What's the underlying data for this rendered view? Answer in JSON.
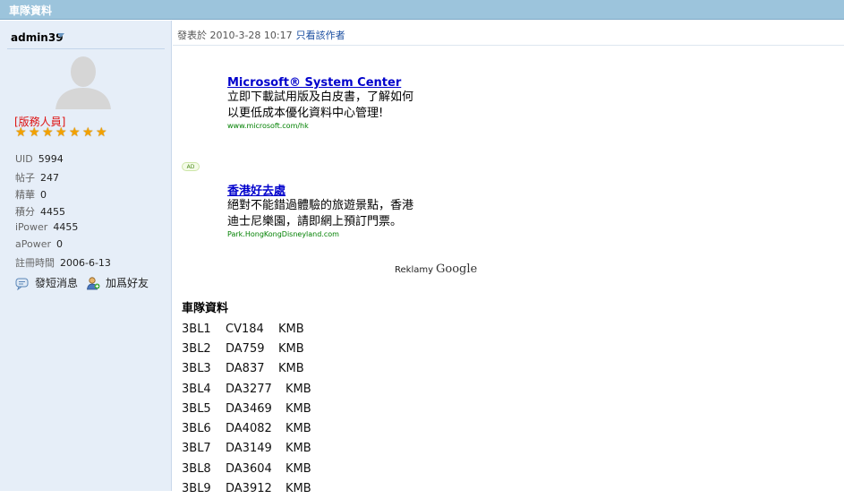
{
  "header": {
    "title": "車隊資料"
  },
  "profile": {
    "username": "admin39",
    "role": "[版務人員]",
    "star_count": 7,
    "stats": [
      {
        "label": "UID",
        "value": "5994"
      },
      {
        "label": "帖子",
        "value": "247"
      },
      {
        "label": "精華",
        "value": "0"
      },
      {
        "label": "積分",
        "value": "4455"
      },
      {
        "label": "iPower",
        "value": "4455"
      },
      {
        "label": "aPower",
        "value": "0"
      },
      {
        "label": "註冊時間",
        "value": "2006-6-13"
      }
    ],
    "actions": {
      "message": "發短消息",
      "add_friend": "加爲好友"
    }
  },
  "post": {
    "posted_at": "發表於 2010-3-28 10:17",
    "author_only_link": "只看該作者",
    "ads": [
      {
        "title": "Microsoft® System Center",
        "line1": "立即下載試用版及白皮書，了解如何",
        "line2": "以更低成本優化資料中心管理!",
        "url": "www.microsoft.com/hk"
      },
      {
        "title": "香港好去處",
        "line1": "絕對不能錯過體驗的旅遊景點，香港",
        "line2": "迪士尼樂園，請即網上預訂門票。",
        "url": "Park.HongKongDisneyland.com"
      }
    ],
    "ad_badge": "AD",
    "ads_label": "Reklamy",
    "ads_brand": "Google",
    "section_title": "車隊資料",
    "rows": [
      {
        "route": "3BL1",
        "code": "CV184",
        "op": "KMB"
      },
      {
        "route": "3BL2",
        "code": "DA759",
        "op": "KMB"
      },
      {
        "route": "3BL3",
        "code": "DA837",
        "op": "KMB"
      },
      {
        "route": "3BL4",
        "code": "DA3277",
        "op": "KMB"
      },
      {
        "route": "3BL5",
        "code": "DA3469",
        "op": "KMB"
      },
      {
        "route": "3BL6",
        "code": "DA4082",
        "op": "KMB"
      },
      {
        "route": "3BL7",
        "code": "DA3149",
        "op": "KMB"
      },
      {
        "route": "3BL8",
        "code": "DA3604",
        "op": "KMB"
      },
      {
        "route": "3BL9",
        "code": "DA3912",
        "op": "KMB"
      }
    ]
  },
  "colors": {
    "titlebar": "#9cc4dc",
    "sidebar_bg": "#e6eef8",
    "link": "#0000cc",
    "ad_url": "#008000",
    "role": "#dd1111",
    "star": "#f2a100"
  },
  "icons": {
    "avatar": "user-silhouette-icon",
    "message": "message-bubble-icon",
    "add_friend": "add-user-icon",
    "dropdown": "chevron-down-icon",
    "star": "star-icon"
  }
}
